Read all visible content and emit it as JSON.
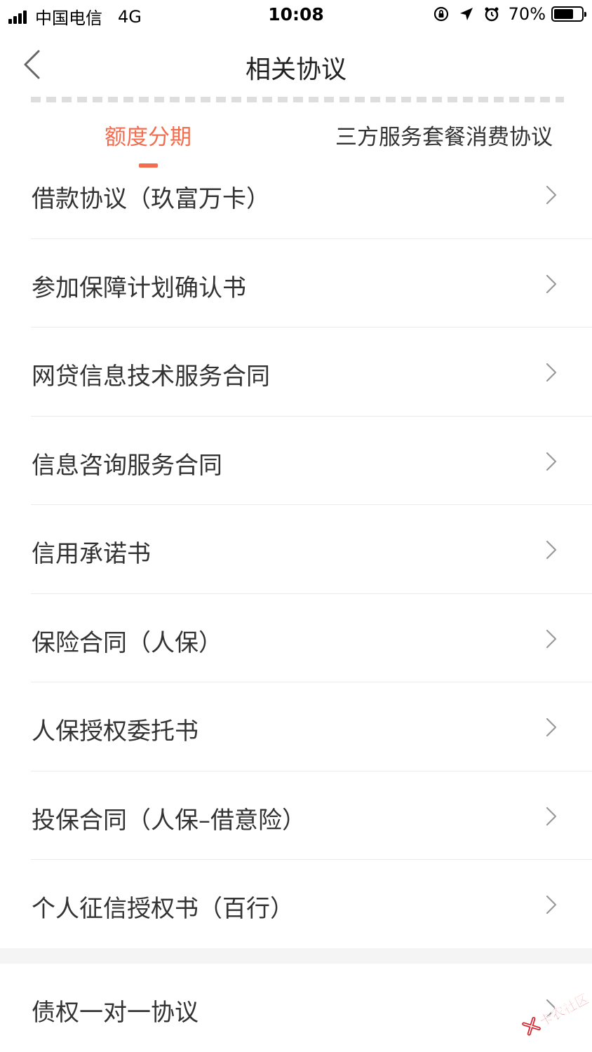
{
  "status_bar": {
    "carrier": "中国电信",
    "network": "4G",
    "time": "10:08",
    "battery_percent": "70%",
    "battery_level": 0.7,
    "icons": [
      "signal-icon",
      "orientation-lock-icon",
      "location-arrow-icon",
      "alarm-clock-icon",
      "battery-icon"
    ]
  },
  "nav": {
    "title": "相关协议",
    "back_icon": "chevron-left-icon"
  },
  "tabs": [
    {
      "label": "额度分期",
      "active": true
    },
    {
      "label": "三方服务套餐消费协议",
      "active": false
    }
  ],
  "colors": {
    "accent": "#f36c4e",
    "text": "#333333",
    "divider": "#ececec",
    "section_bg": "#f4f4f4"
  },
  "agreements": [
    {
      "label": "借款协议（玖富万卡）"
    },
    {
      "label": "参加保障计划确认书"
    },
    {
      "label": "网贷信息技术服务合同"
    },
    {
      "label": "信息咨询服务合同"
    },
    {
      "label": "信用承诺书"
    },
    {
      "label": "保险合同（人保）"
    },
    {
      "label": "人保授权委托书"
    },
    {
      "label": "投保合同（人保–借意险）"
    },
    {
      "label": "个人征信授权书（百行）"
    }
  ],
  "second_section": {
    "label": "债权一对一协议"
  },
  "watermark": {
    "text": "卡农社区"
  }
}
